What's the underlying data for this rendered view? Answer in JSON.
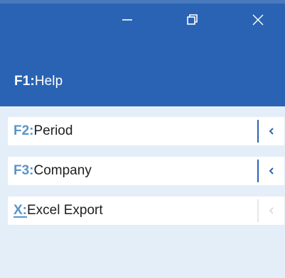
{
  "window": {
    "controls": {
      "minimize_icon": "minimize-icon",
      "restore_icon": "restore-icon",
      "close_icon": "close-icon"
    }
  },
  "header": {
    "help": {
      "key": "F1:",
      "label": "Help"
    }
  },
  "menu": {
    "items": [
      {
        "key": "F2:",
        "label": "Period",
        "enabled": true,
        "icon": "chevron-left-icon"
      },
      {
        "key": "F3:",
        "label": "Company",
        "enabled": true,
        "icon": "chevron-left-icon"
      },
      {
        "key": "X:",
        "label": "Excel Export",
        "enabled": false,
        "icon": "chevron-left-icon"
      }
    ]
  },
  "colors": {
    "header_bg": "#2a63b3",
    "panel_bg": "#e4eef8",
    "key_color": "#5a94c8",
    "accent": "#2a63b3"
  }
}
